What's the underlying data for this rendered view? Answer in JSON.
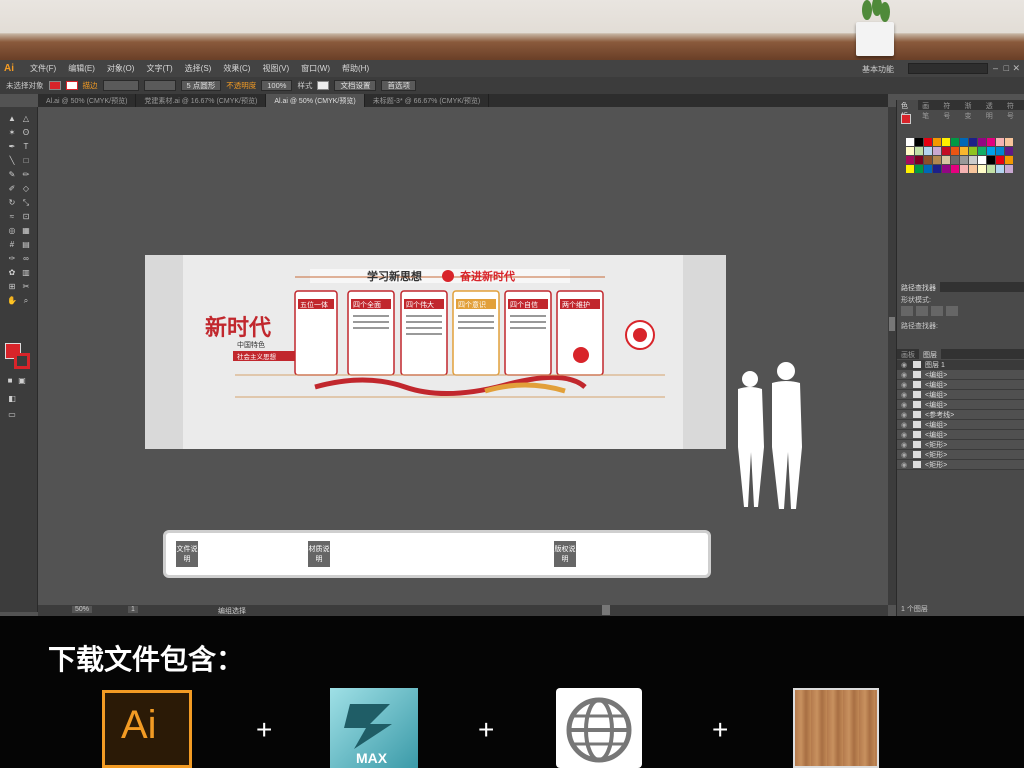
{
  "menubar": {
    "logo": "Ai",
    "items": [
      "文件(F)",
      "编辑(E)",
      "对象(O)",
      "文字(T)",
      "选择(S)",
      "效果(C)",
      "视图(V)",
      "窗口(W)",
      "帮助(H)"
    ],
    "workspace": "基本功能"
  },
  "control_bar": {
    "selection": "未选择对象",
    "stroke_label": "描边",
    "stroke_weight": "5 点圆形",
    "opacity_label": "不透明度",
    "opacity_value": "100%",
    "style_label": "样式",
    "doc_setup": "文档设置",
    "prefs": "首选项"
  },
  "tabs": [
    {
      "label": "Al.ai @ 50% (CMYK/预览)",
      "active": false
    },
    {
      "label": "党建素材.ai @ 16.67% (CMYK/预览)",
      "active": false
    },
    {
      "label": "Al.ai @ 50% (CMYK/预览)",
      "active": true
    },
    {
      "label": "未标题-3* @ 66.67% (CMYK/预览)",
      "active": false
    }
  ],
  "right_panel": {
    "swatch_tabs": [
      "色板",
      "画笔",
      "符号",
      "渐变",
      "透明",
      "符号"
    ],
    "pathfinder_tabs": [
      "路径查找器"
    ],
    "shape_modes": "形状模式:",
    "pathfinder_label": "路径查找器:",
    "layer_tabs": [
      "画板",
      "图层"
    ],
    "layers": [
      {
        "name": "图层 1",
        "selected": true
      },
      {
        "name": "<编组>"
      },
      {
        "name": "<编组>"
      },
      {
        "name": "<编组>"
      },
      {
        "name": "<编组>"
      },
      {
        "name": "<参考线>"
      },
      {
        "name": "<编组>"
      },
      {
        "name": "<编组>"
      },
      {
        "name": "<矩形>"
      },
      {
        "name": "<矩形>"
      },
      {
        "name": "<矩形>"
      }
    ],
    "layer_count": "1 个图层"
  },
  "status": {
    "zoom": "50%",
    "page": "1",
    "tool": "编组选择"
  },
  "artwork": {
    "banner_left": "学习新思想",
    "banner_right": "奋进新时代",
    "brand_title": "新时代",
    "brand_sub": "中国特色",
    "brand_sub2": "社会主义思想",
    "cards": [
      "五位一体",
      "四个全面",
      "四个伟大",
      "四个意识",
      "四个自信",
      "两个维护"
    ],
    "notes": [
      "文件说明",
      "材质说明",
      "版权说明"
    ]
  },
  "band": {
    "title": "下载文件包含：",
    "products": [
      {
        "name": "ai-file-icon",
        "label": "Ai"
      },
      {
        "name": "3ds-max-icon",
        "label": "MAX"
      },
      {
        "name": "globe-web-icon",
        "label": ""
      },
      {
        "name": "wood-texture-icon",
        "label": ""
      }
    ],
    "plus": "+"
  },
  "colors": {
    "accent": "#d8242a",
    "ai_orange": "#f29b24",
    "panel": "#4a4a4a"
  }
}
